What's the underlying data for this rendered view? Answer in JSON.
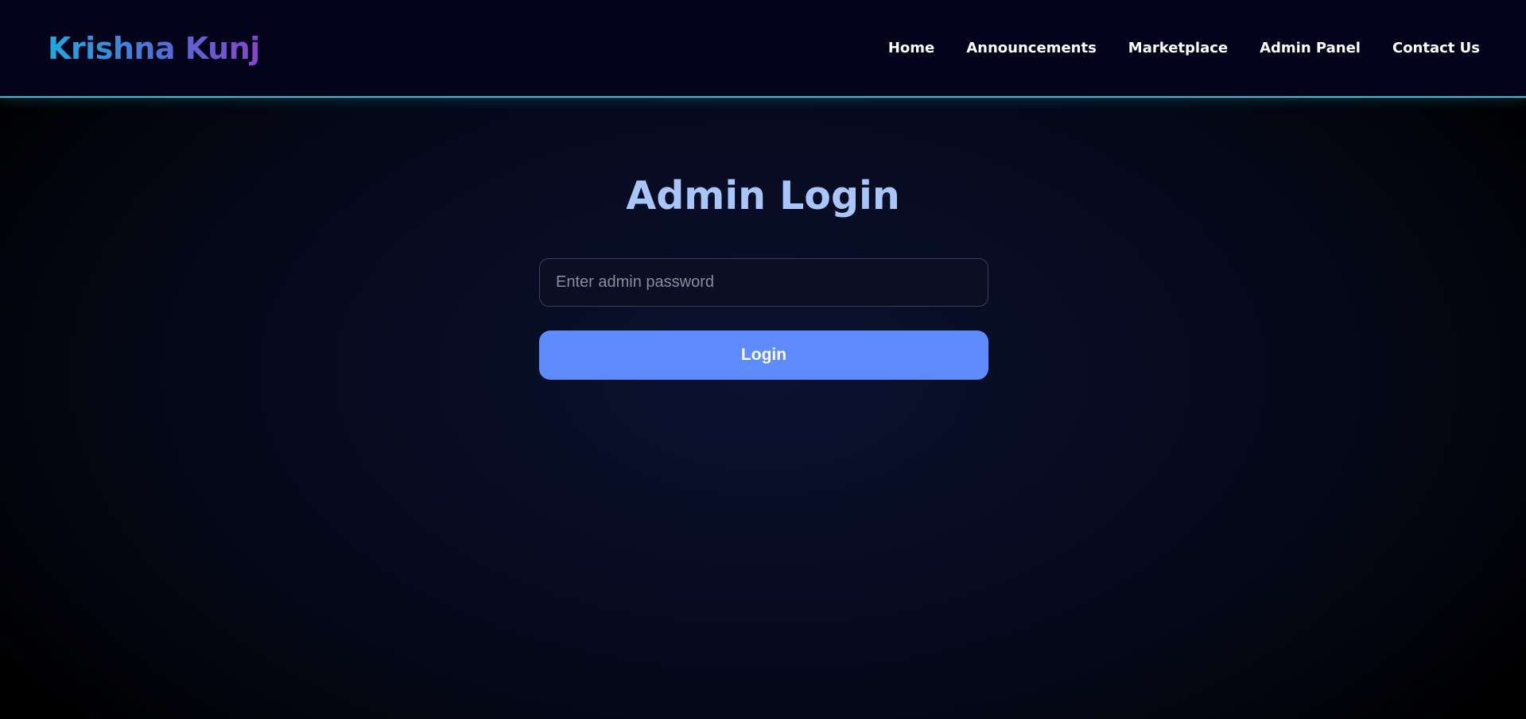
{
  "brand": {
    "name": "Krishna Kunj",
    "gradient_colors": [
      "#20a9dd",
      "#4f6fd4",
      "#8a43cc"
    ]
  },
  "nav": {
    "items": [
      {
        "label": "Home"
      },
      {
        "label": "Announcements"
      },
      {
        "label": "Marketplace"
      },
      {
        "label": "Admin Panel"
      },
      {
        "label": "Contact Us"
      }
    ]
  },
  "login": {
    "title": "Admin Login",
    "password_placeholder": "Enter admin password",
    "password_value": "",
    "button_label": "Login"
  },
  "colors": {
    "nav_background": "#04031c",
    "nav_border": "#23c6dc",
    "title": "#a9c6fb",
    "button": "#5e8cfe"
  }
}
